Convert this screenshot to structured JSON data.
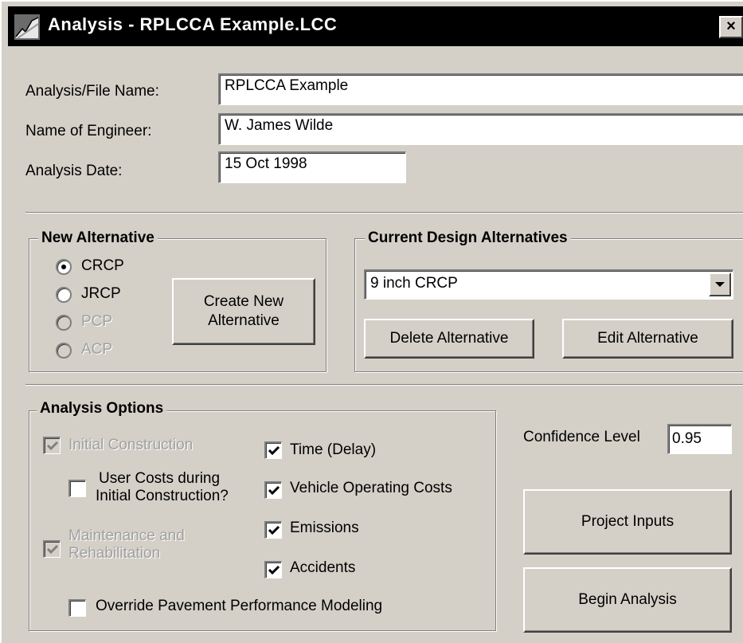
{
  "window": {
    "title": "Analysis - RPLCCA Example.LCC",
    "close_label": "×"
  },
  "fields": {
    "file_name_label": "Analysis/File Name:",
    "file_name_value": "RPLCCA Example",
    "engineer_label": "Name of Engineer:",
    "engineer_value": "W. James Wilde",
    "date_label": "Analysis Date:",
    "date_value": "15 Oct 1998"
  },
  "new_alternative": {
    "title": "New Alternative",
    "options": [
      {
        "label": "CRCP",
        "selected": true,
        "enabled": true
      },
      {
        "label": "JRCP",
        "selected": false,
        "enabled": true
      },
      {
        "label": "PCP",
        "selected": false,
        "enabled": false
      },
      {
        "label": "ACP",
        "selected": false,
        "enabled": false
      }
    ],
    "create_button_line1": "Create New",
    "create_button_line2": "Alternative"
  },
  "current_alternatives": {
    "title": "Current Design Alternatives",
    "selected": "9 inch CRCP",
    "delete_button": "Delete Alternative",
    "edit_button": "Edit Alternative"
  },
  "analysis_options": {
    "title": "Analysis Options",
    "initial_construction": "Initial Construction",
    "user_costs_line1": "User Costs during",
    "user_costs_line2": "Initial Construction?",
    "maintenance_line1": "Maintenance and",
    "maintenance_line2": "Rehabilitation",
    "time_delay": "Time (Delay)",
    "vehicle_operating": "Vehicle Operating Costs",
    "emissions": "Emissions",
    "accidents": "Accidents",
    "override": "Override Pavement Performance Modeling"
  },
  "confidence": {
    "label": "Confidence Level",
    "value": "0.95"
  },
  "buttons": {
    "project_inputs": "Project Inputs",
    "begin_analysis": "Begin Analysis"
  }
}
